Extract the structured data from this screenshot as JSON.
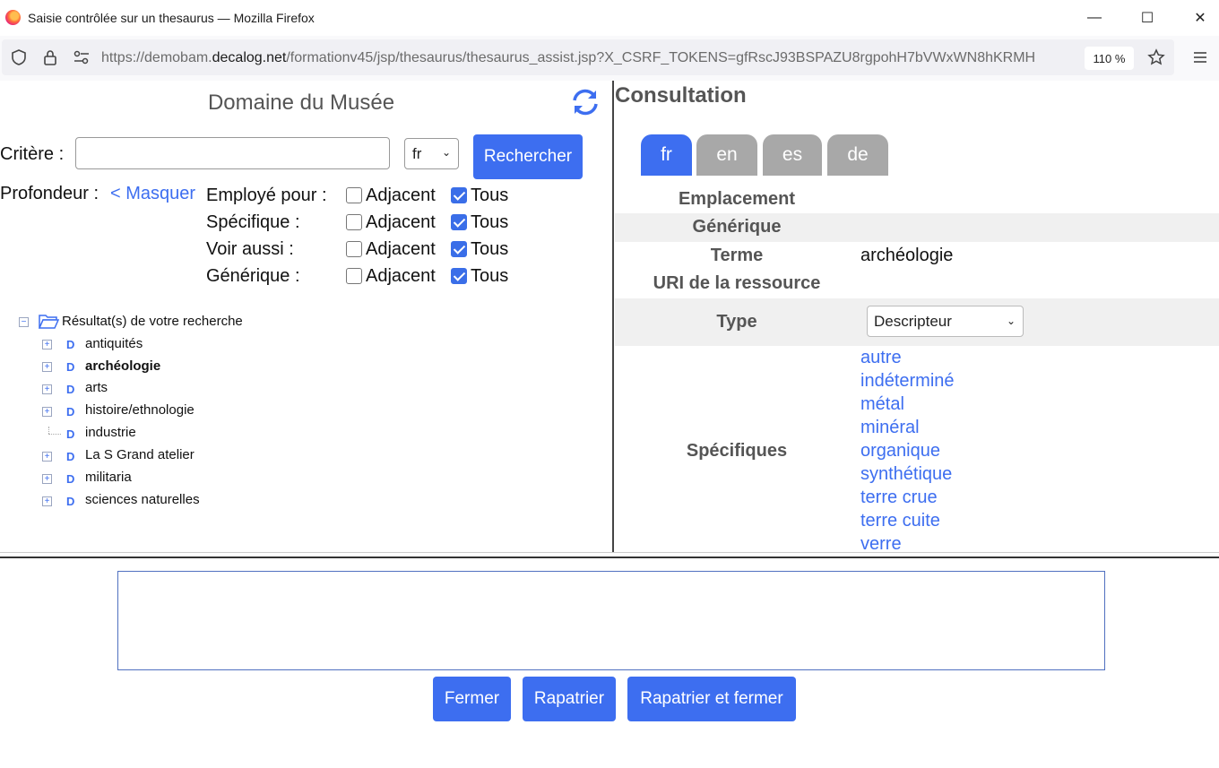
{
  "window": {
    "title": "Saisie contrôlée sur un thesaurus — Mozilla Firefox",
    "minimize": "—",
    "maximize": "☐",
    "close": "✕"
  },
  "nav": {
    "url_prefix": "https://demobam.",
    "url_domain": "decalog.net",
    "url_path": "/formationv45/jsp/thesaurus/thesaurus_assist.jsp?X_CSRF_TOKENS=gfRscJ93BSPAZU8rgpohH7bVWxWN8hKRMH",
    "zoom": "110 %"
  },
  "left": {
    "domain_title": "Domaine du Musée",
    "criteria_label": "Critère :",
    "criteria_value": "",
    "lang_selected": "fr",
    "search_button": "Rechercher",
    "depth_label": "Profondeur :",
    "hide_link": "< Masquer",
    "relations": [
      {
        "label": "Employé pour :",
        "adjacent": "Adjacent",
        "adjacent_checked": false,
        "all": "Tous",
        "all_checked": true
      },
      {
        "label": "Spécifique :",
        "adjacent": "Adjacent",
        "adjacent_checked": false,
        "all": "Tous",
        "all_checked": true
      },
      {
        "label": "Voir aussi :",
        "adjacent": "Adjacent",
        "adjacent_checked": false,
        "all": "Tous",
        "all_checked": true
      },
      {
        "label": "Générique :",
        "adjacent": "Adjacent",
        "adjacent_checked": false,
        "all": "Tous",
        "all_checked": true
      }
    ],
    "tree": {
      "root": "Résultat(s) de votre recherche",
      "root_toggle": "−",
      "node_letter": "D",
      "expand": "+",
      "items": [
        {
          "label": "antiquités",
          "expandable": true,
          "selected": false
        },
        {
          "label": "archéologie",
          "expandable": true,
          "selected": true
        },
        {
          "label": "arts",
          "expandable": true,
          "selected": false
        },
        {
          "label": "histoire/ethnologie",
          "expandable": true,
          "selected": false
        },
        {
          "label": "industrie",
          "expandable": false,
          "selected": false
        },
        {
          "label": "La S Grand atelier",
          "expandable": true,
          "selected": false
        },
        {
          "label": "militaria",
          "expandable": true,
          "selected": false
        },
        {
          "label": "sciences naturelles",
          "expandable": true,
          "selected": false
        }
      ]
    }
  },
  "right": {
    "title": "Consultation",
    "tabs": [
      "fr",
      "en",
      "es",
      "de"
    ],
    "active_tab": "fr",
    "props": {
      "emplacement": "Emplacement",
      "generique": "Générique",
      "terme_label": "Terme",
      "terme_value": "archéologie",
      "uri_label": "URI de la ressource",
      "type_label": "Type",
      "type_value": "Descripteur",
      "specifiques_label": "Spécifiques"
    },
    "specifiques": [
      "autre",
      "indéterminé",
      "métal",
      "minéral",
      "organique",
      "synthétique",
      "terre crue",
      "terre cuite",
      "verre"
    ]
  },
  "bottom": {
    "close": "Fermer",
    "repatriate": "Rapatrier",
    "repatriate_close": "Rapatrier et fermer"
  },
  "colors": {
    "accent": "#3d6ef0",
    "tab_inactive": "#a8a8a8",
    "band": "#f0f0f0"
  }
}
